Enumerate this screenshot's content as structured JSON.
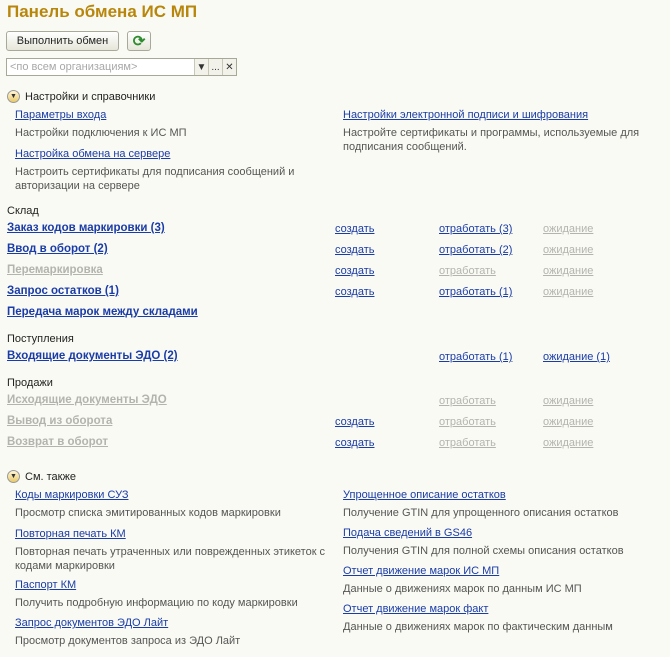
{
  "title": "Панель обмена ИС МП",
  "toolbar": {
    "exchange_label": "Выполнить обмен",
    "refresh_icon": "refresh-icon",
    "org_placeholder": "<по всем организациям>",
    "more_label": "..."
  },
  "settings": {
    "header": "Настройки и справочники",
    "left": [
      {
        "link": "Параметры входа",
        "desc": "Настройки подключения к ИС МП"
      },
      {
        "link": "Настройка обмена на сервере",
        "desc": "Настроить сертификаты для подписания сообщений и авторизации на сервере"
      }
    ],
    "right": [
      {
        "link": "Настройки электронной подписи и шифрования",
        "desc": "Настройте сертификаты и программы, используемые для подписания сообщений."
      }
    ]
  },
  "groups": {
    "warehouse": "Склад",
    "receipts": "Поступления",
    "sales": "Продажи"
  },
  "rows": [
    {
      "name": "Заказ кодов маркировки (3)",
      "disabled": false,
      "create": "создать",
      "create_dis": false,
      "process": "отработать (3)",
      "process_dis": false,
      "wait": "ожидание",
      "wait_dis": true
    },
    {
      "name": "Ввод в оборот (2)",
      "disabled": false,
      "create": "создать",
      "create_dis": false,
      "process": "отработать (2)",
      "process_dis": false,
      "wait": "ожидание",
      "wait_dis": true
    },
    {
      "name": "Перемаркировка",
      "disabled": true,
      "create": "создать",
      "create_dis": false,
      "process": "отработать",
      "process_dis": true,
      "wait": "ожидание",
      "wait_dis": true
    },
    {
      "name": "Запрос остатков (1)",
      "disabled": false,
      "create": "создать",
      "create_dis": false,
      "process": "отработать (1)",
      "process_dis": false,
      "wait": "ожидание",
      "wait_dis": true
    },
    {
      "name": "Передача марок между складами",
      "disabled": false,
      "create": "",
      "create_dis": false,
      "process": "",
      "process_dis": false,
      "wait": "",
      "wait_dis": false
    },
    {
      "name": "Входящие документы ЭДО (2)",
      "disabled": false,
      "create": "",
      "create_dis": false,
      "process": "отработать (1)",
      "process_dis": false,
      "wait": "ожидание (1)",
      "wait_dis": false
    },
    {
      "name": "Исходящие документы ЭДО",
      "disabled": true,
      "create": "",
      "create_dis": false,
      "process": "отработать",
      "process_dis": true,
      "wait": "ожидание",
      "wait_dis": true
    },
    {
      "name": "Вывод из оборота",
      "disabled": true,
      "create": "создать",
      "create_dis": false,
      "process": "отработать",
      "process_dis": true,
      "wait": "ожидание",
      "wait_dis": true
    },
    {
      "name": "Возврат в оборот",
      "disabled": true,
      "create": "создать",
      "create_dis": false,
      "process": "отработать",
      "process_dis": true,
      "wait": "ожидание",
      "wait_dis": true
    }
  ],
  "see_also": {
    "header": "См. также",
    "left": [
      {
        "link": "Коды маркировки СУЗ",
        "desc": "Просмотр списка эмитированных кодов маркировки"
      },
      {
        "link": "Повторная печать КМ",
        "desc": "Повторная печать утраченных или поврежденных этикеток с кодами маркировки"
      },
      {
        "link": "Паспорт КМ",
        "desc": "Получить подробную информацию по коду маркировки"
      },
      {
        "link": "Запрос документов ЭДО Лайт",
        "desc": "Просмотр документов запроса из ЭДО Лайт"
      }
    ],
    "right": [
      {
        "link": "Упрощенное описание остатков",
        "desc": "Получение GTIN для упрощенного описания остатков"
      },
      {
        "link": "Подача сведений в GS46",
        "desc": "Получения GTIN для полной схемы описания остатков"
      },
      {
        "link": "Отчет движение марок ИС МП",
        "desc": "Данные о движениях марок по данным ИС МП"
      },
      {
        "link": "Отчет движение марок факт",
        "desc": "Данные о движениях марок по фактическим данным"
      }
    ]
  }
}
